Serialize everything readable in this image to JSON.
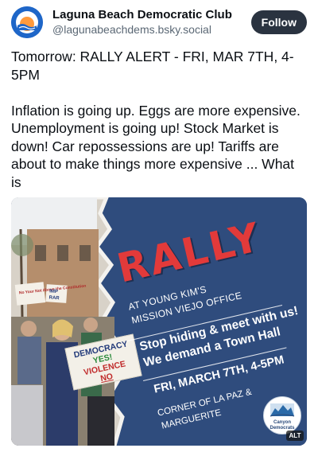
{
  "post": {
    "display_name": "Laguna Beach Democratic Club",
    "handle": "@lagunabeachdems.bsky.social",
    "avatar_text": "LAGUNA BEACH DEMOCRATIC CLUB",
    "follow_label": "Follow",
    "text": "Tomorrow: RALLY ALERT - FRI, MAR 7TH, 4-5PM\n\nInflation is going up. Eggs are more expensive. Unemployment is going up! Stock Market is down!  Car repossessions are up! Tariffs are about to make things more expensive ...  What is"
  },
  "flyer": {
    "title": "RALLY",
    "office_line_1": "AT YOUNG KIM'S",
    "office_line_2": "MISSION VIEJO OFFICE",
    "stop_line_1": "Stop hiding & meet with us!",
    "stop_line_2": "We demand a Town Hall",
    "date_line": "FRI, MARCH 7TH, 4-5PM",
    "corner_line_1": "CORNER OF LA PAZ &",
    "corner_line_2": "MARGUERITE",
    "sign": [
      "DEMOCRACY",
      "YES!",
      "VIOLENCE",
      "NO"
    ],
    "small_signs": [
      "No Your Not Above the Constitution",
      "IMP",
      "RAR"
    ],
    "logo_text": "Canyon Democrats",
    "alt_label": "ALT",
    "colors": {
      "panel": "#2f4c7d",
      "title": "#e23a3a"
    }
  },
  "icons": [
    "avatar-logo",
    "canyon-democrats-logo"
  ]
}
